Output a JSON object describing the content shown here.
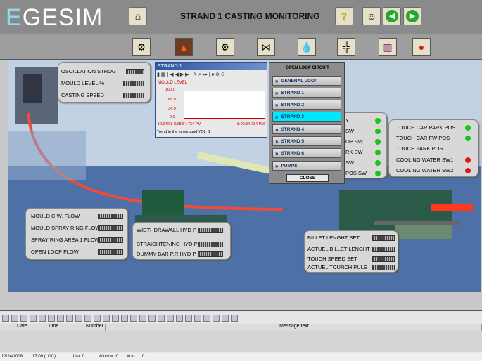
{
  "header": {
    "logo_first": "E",
    "logo_rest": "GESIM",
    "title": "STRAND 1 CASTING MONITORING"
  },
  "icons": {
    "home": "home-icon",
    "help": "help-icon",
    "user": "user-icon",
    "back": "arrow-left-icon",
    "forward": "arrow-right-icon"
  },
  "panel_oscillation": {
    "rows": [
      "OSCILLATION STROG",
      "MOULD LEVEL %",
      "CASTING SPEED"
    ]
  },
  "trend": {
    "title": "STRAND 1",
    "series_label": "MOULD LEVEL",
    "y_ticks": [
      "100.0",
      "68.0",
      "34.0",
      "0.0"
    ],
    "x_start": "12/24/08",
    "x_start_time": "8:08:54.734 PM",
    "x_end_time": "8:09:54.734 PM",
    "footer": "Trend in the foreground YOL_1"
  },
  "menu": {
    "title": "OPEN LOOP CIRCUIT",
    "items": [
      "GENERAL LOOP",
      "STRAND 1",
      "STRAND 2",
      "STRAND 3",
      "STRAND 4",
      "STRAND 5",
      "STRAND 6",
      "PUMPS"
    ],
    "close_label": "CLOSE"
  },
  "panel_sw": {
    "rows": [
      "Y",
      "SW",
      "OP SW",
      "RK SW",
      "SW",
      "POS SW"
    ]
  },
  "panel_touch": {
    "rows": [
      "TOUCH CAR PARK POS",
      "TOUCH CAR FW POS",
      "TOUCH PARK POS",
      "COOLING WATER SW1",
      "COOLING WATER SW2"
    ],
    "status_colors": {
      "green": "#19c51d",
      "red": "#e21818"
    }
  },
  "panel_mould": {
    "rows": [
      "MOULD C.W. FLOW",
      "MOULD SPRAY RING FLOW",
      "SPRAY RING AREA 1 FLOW",
      "OPEN LOOP FLOW"
    ]
  },
  "panel_hyd": {
    "rows": [
      "WIDTHDRAWALL HYD P",
      "STRAIGHTENING HYD P",
      "DUMMY BAR P.R.HYD P"
    ]
  },
  "panel_billet": {
    "rows": [
      "BILLET LENGHT SET",
      "ACTUEL BILLET LENGHT",
      "TOUCH SPEED SET",
      "ACTUEL TOURCH PULS"
    ]
  },
  "messages": {
    "columns": [
      "Date",
      "Time",
      "Number",
      "Message text"
    ]
  },
  "status_bar": {
    "date": "12/24/2008",
    "time": "17:09 (LOC)",
    "list": "List: 0",
    "window": "Window: 0",
    "ack": "Ack:",
    "ack_value": "0"
  }
}
